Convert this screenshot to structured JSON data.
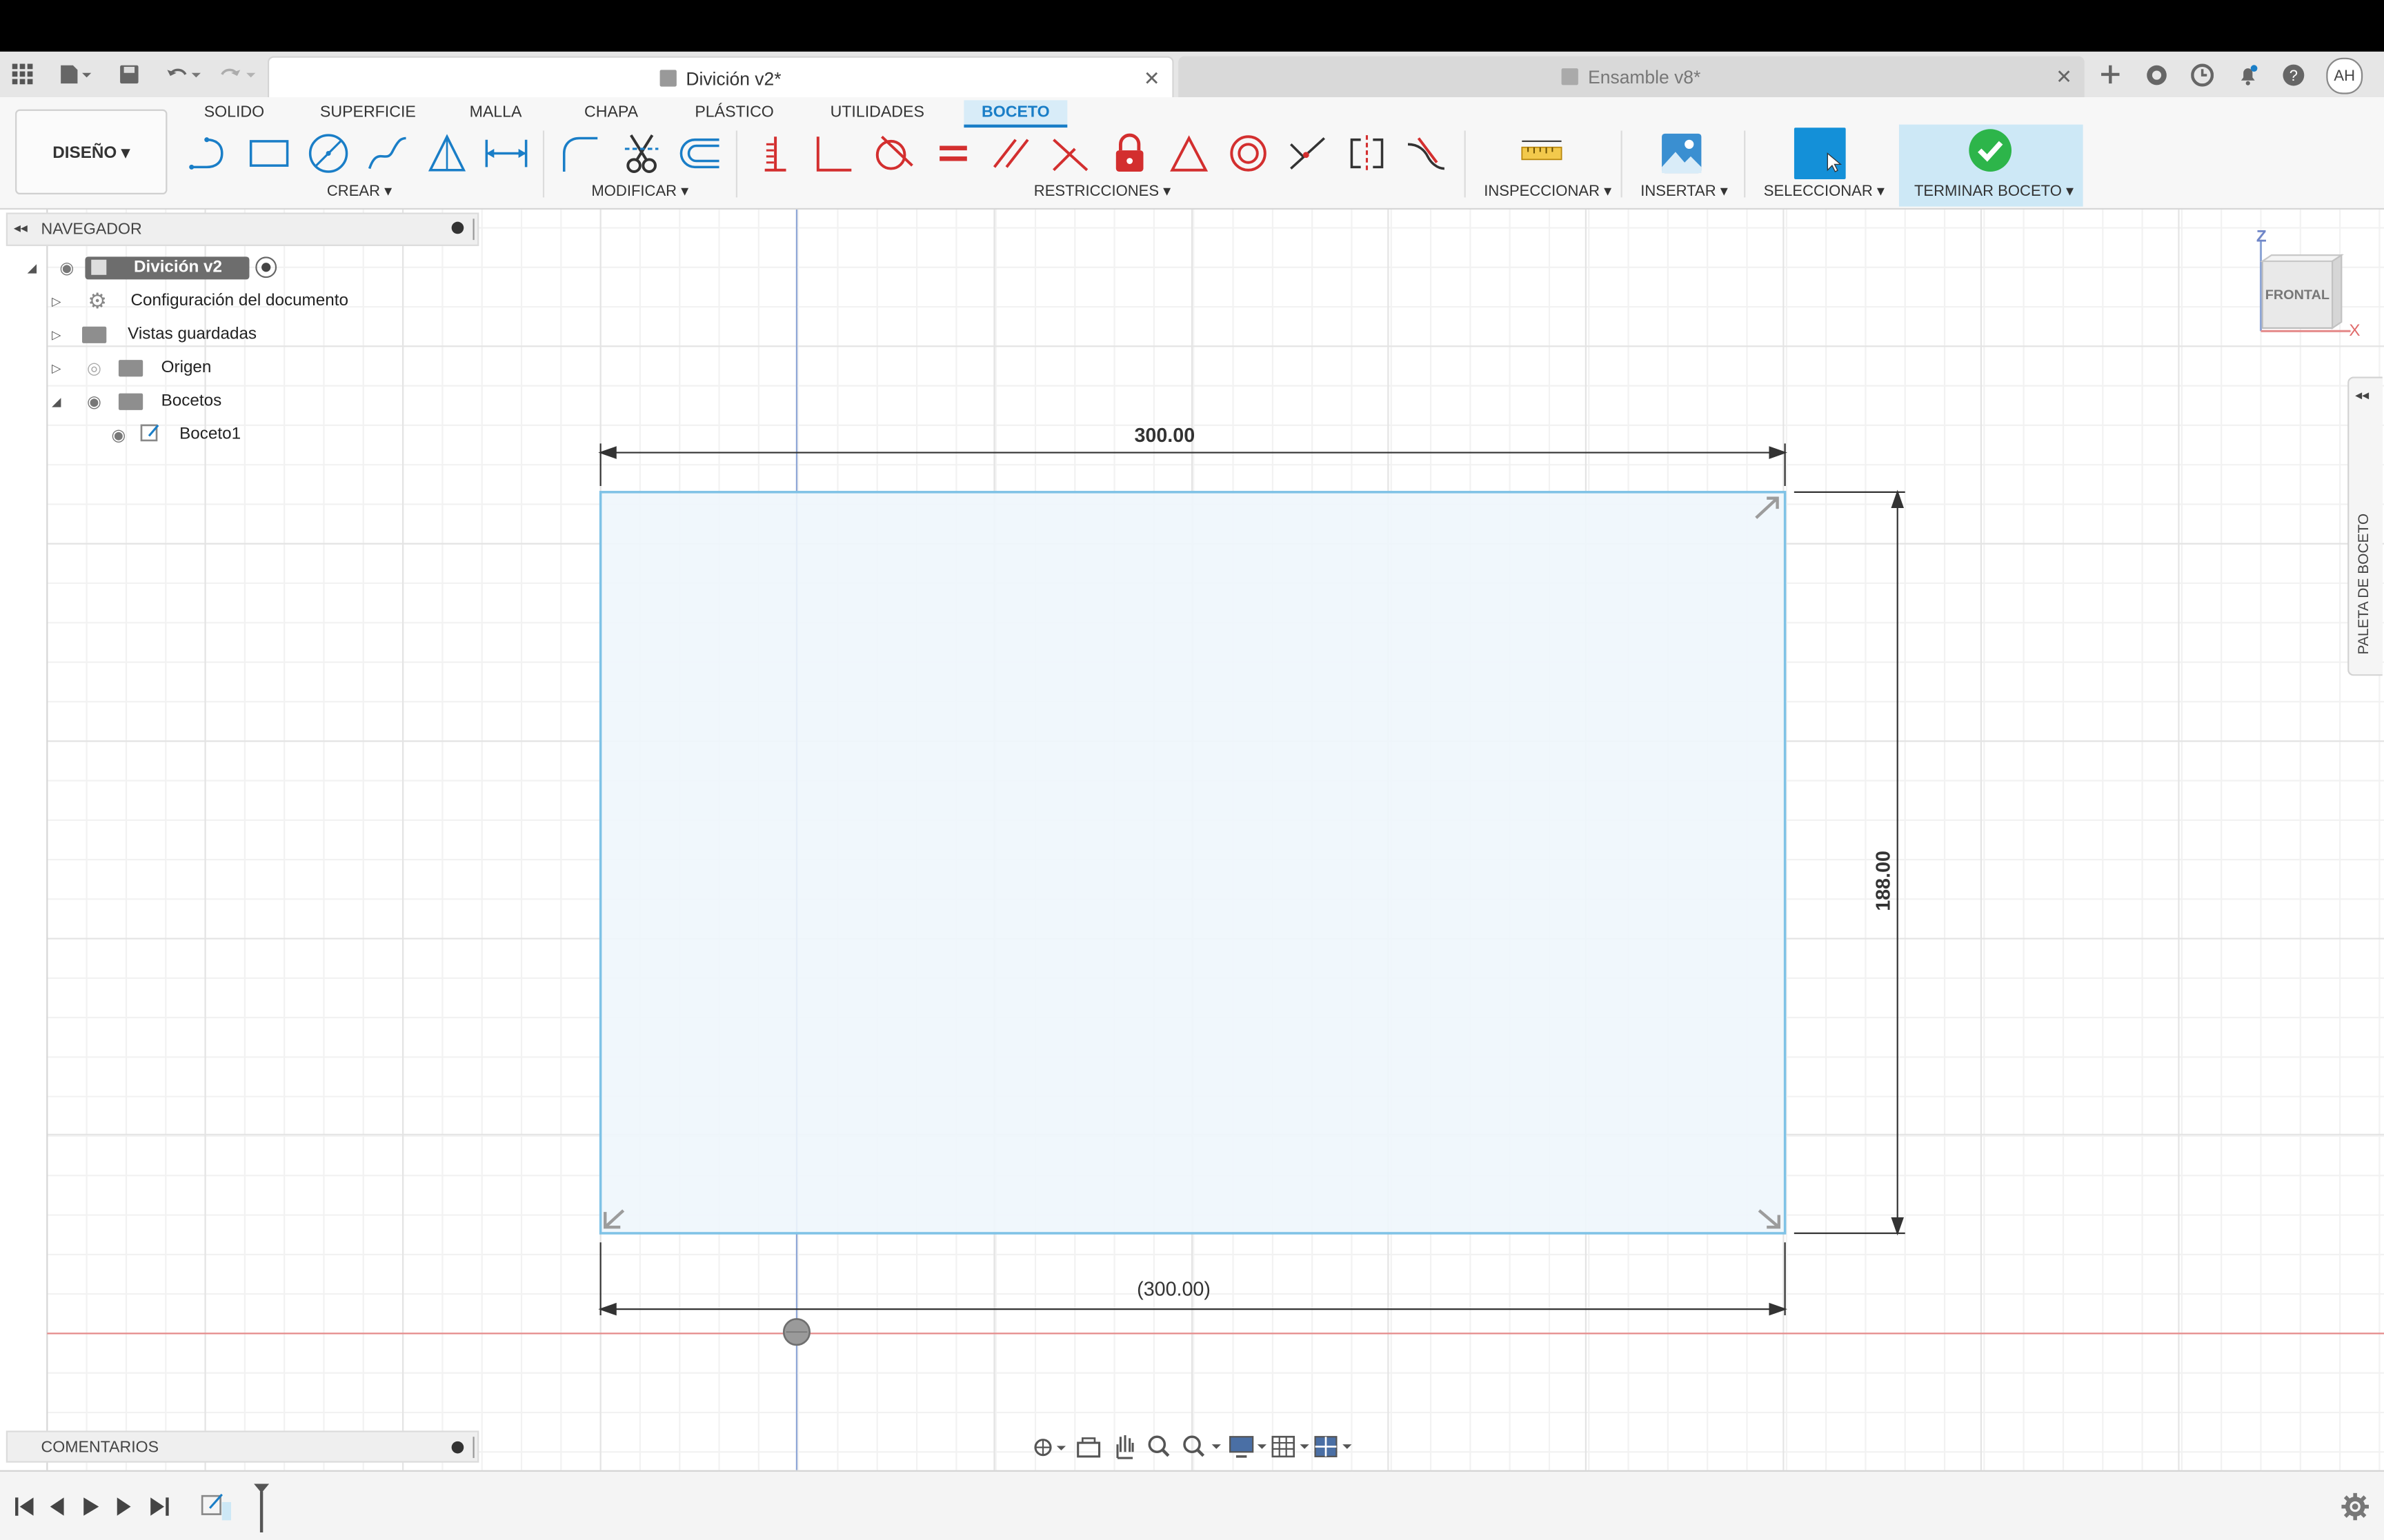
{
  "app": {
    "active_tab": "Divición v2*",
    "inactive_tab": "Ensamble v8*",
    "user_initials": "AH"
  },
  "toolbar": {
    "workspace": "DISEÑO ▾",
    "tabs": [
      "SOLIDO",
      "SUPERFICIE",
      "MALLA",
      "CHAPA",
      "PLÁSTICO",
      "UTILIDADES",
      "BOCETO"
    ],
    "active_tab": "BOCETO",
    "groups": {
      "crear": "CREAR ▾",
      "modificar": "MODIFICAR ▾",
      "restricciones": "RESTRICCIONES ▾",
      "inspeccionar": "INSPECCIONAR ▾",
      "insertar": "INSERTAR ▾",
      "seleccionar": "SELECCIONAR ▾",
      "terminar": "TERMINAR BOCETO ▾"
    }
  },
  "browser": {
    "title": "NAVEGADOR",
    "root": "Divición v2",
    "items": [
      {
        "label": "Configuración del documento",
        "icon": "gear-icon"
      },
      {
        "label": "Vistas guardadas",
        "icon": "folder-icon"
      },
      {
        "label": "Origen",
        "icon": "folder-icon"
      },
      {
        "label": "Bocetos",
        "icon": "folder-icon"
      },
      {
        "label": "Boceto1",
        "icon": "sketch-icon"
      }
    ]
  },
  "canvas": {
    "dim_width": "300.00",
    "dim_height": "188.00",
    "dim_ref": "(300.00)"
  },
  "viewcube": {
    "face": "FRONTAL",
    "axis_z": "Z",
    "axis_x": "X"
  },
  "palette": {
    "label": "PALETA DE BOCETO"
  },
  "comments": {
    "title": "COMENTARIOS"
  },
  "colors": {
    "accent": "#1a7ec7",
    "select_blue": "#1490d8",
    "finish_bg": "#cde8f6",
    "finish_green": "#2db54a",
    "constraint_red": "#d32f2f",
    "sketch_fill": "#eef6fc",
    "sketch_line": "#7fc2e6",
    "grid": "#e4e4e4",
    "x_axis": "#e58b8b",
    "z_axis": "#8ea6d6"
  }
}
